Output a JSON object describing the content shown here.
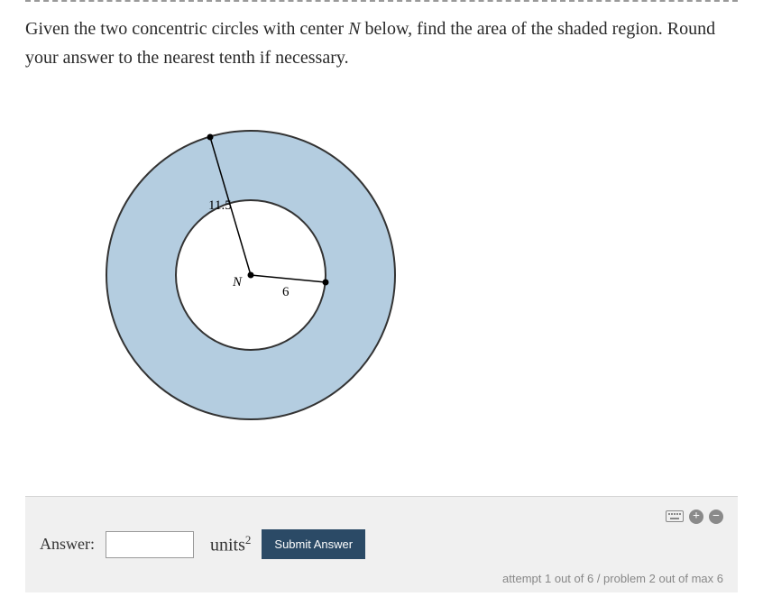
{
  "question": {
    "prefix": "Given the two concentric circles with center ",
    "center_label": "N",
    "suffix": " below, find the area of the shaded region. Round your answer to the nearest tenth if necessary."
  },
  "diagram": {
    "outer_radius_label": "11.5",
    "inner_radius_label": "6",
    "center_point_label": "N"
  },
  "answer_section": {
    "label": "Answer:",
    "input_value": "",
    "units": "units",
    "units_exponent": "2",
    "submit_label": "Submit Answer"
  },
  "footer": {
    "attempt_text": "attempt 1 out of 6 / problem 2 out of max 6"
  },
  "icons": {
    "keyboard": "keyboard-icon",
    "plus": "+",
    "minus": "−"
  },
  "chart_data": {
    "type": "diagram",
    "shape": "concentric-circles-annulus",
    "center": "N",
    "outer_radius": 11.5,
    "inner_radius": 6,
    "shaded_region": "annulus"
  }
}
